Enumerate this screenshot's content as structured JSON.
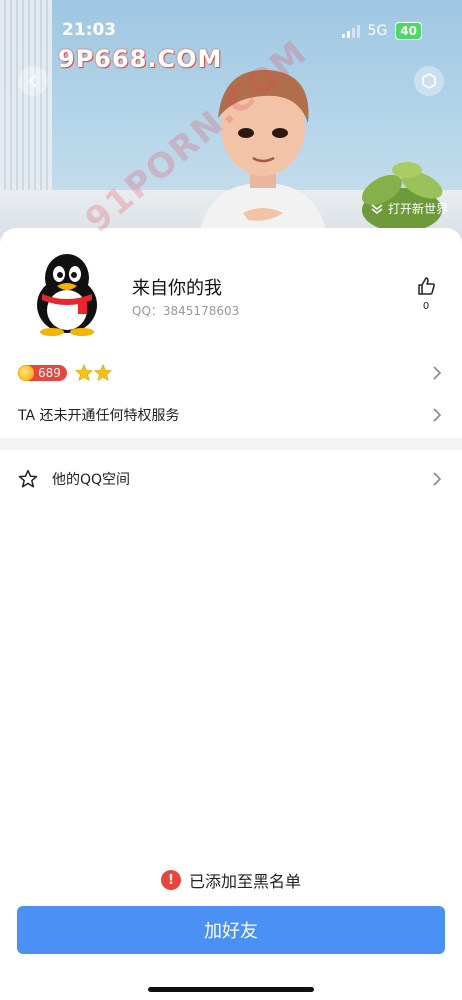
{
  "status_bar": {
    "time": "21:03",
    "network": "5G",
    "battery": "40"
  },
  "watermarks": {
    "top": "9P668.COM",
    "diagonal": "91PORN.COM"
  },
  "hero": {
    "open_world_label": "打开新世界"
  },
  "profile": {
    "name": "来自你的我",
    "qq_label": "QQ：3845178603",
    "like_count": "0"
  },
  "level": {
    "points": "689"
  },
  "privilege": {
    "label": "TA 还未开通任何特权服务"
  },
  "qzone": {
    "label": "他的QQ空间"
  },
  "blacklist": {
    "notice": "已添加至黑名单"
  },
  "actions": {
    "add_friend": "加好友"
  },
  "colors": {
    "accent": "#4a90f5",
    "warning": "#e8453c"
  },
  "icons": [
    "back-icon",
    "hexagon-icon",
    "chevron-down-icon",
    "like-icon",
    "star-icon",
    "chevron-right-icon",
    "warning-icon"
  ]
}
